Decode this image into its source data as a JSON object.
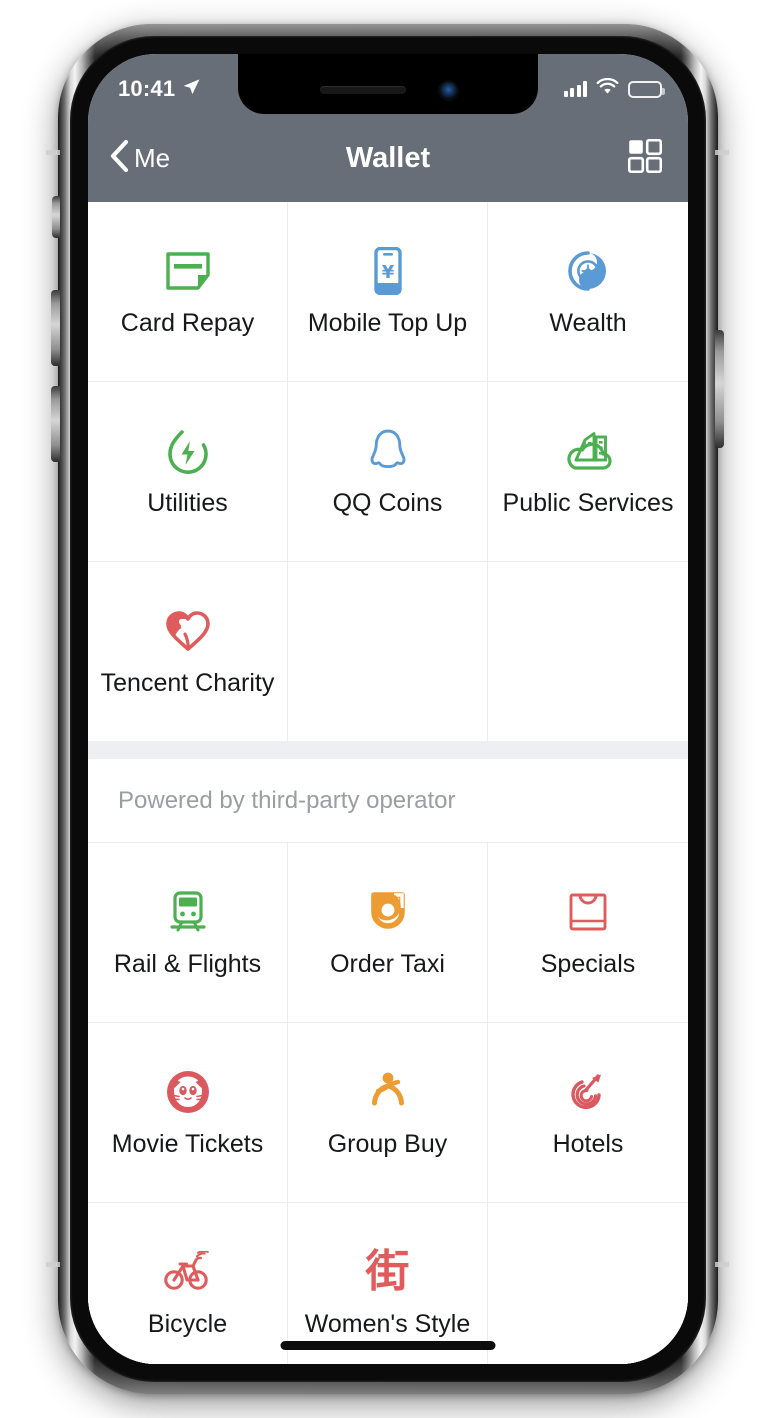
{
  "status_bar": {
    "time": "10:41",
    "location_icon": "location-arrow-icon",
    "signal_icon": "cellular-signal-icon",
    "wifi_icon": "wifi-icon",
    "battery_icon": "battery-icon"
  },
  "nav_bar": {
    "back_label": "Me",
    "back_icon": "chevron-left-icon",
    "title": "Wallet",
    "grid_icon": "grid-menu-icon"
  },
  "theme": {
    "nav_background": "#676e78",
    "green": "#4cb050",
    "blue": "#5b9bd5",
    "red": "#e05c5c",
    "orange": "#ed9b33",
    "battery_yellow": "#f7c744",
    "divider": "#eceded",
    "section_gap": "#eeeff2",
    "label_text": "#16181a",
    "muted_text": "#9a9da1"
  },
  "sections": [
    {
      "name": "wallet-services",
      "header": null,
      "rows": [
        [
          {
            "label": "Card Repay",
            "icon": "card-repay-icon",
            "color": "#4cb050",
            "empty": false
          },
          {
            "label": "Mobile Top Up",
            "icon": "mobile-topup-icon",
            "color": "#5b9bd5",
            "empty": false
          },
          {
            "label": "Wealth",
            "icon": "wealth-icon",
            "color": "#5b9bd5",
            "empty": false
          }
        ],
        [
          {
            "label": "Utilities",
            "icon": "utilities-icon",
            "color": "#4cb050",
            "empty": false
          },
          {
            "label": "QQ Coins",
            "icon": "qq-coins-icon",
            "color": "#5b9bd5",
            "empty": false
          },
          {
            "label": "Public Services",
            "icon": "public-services-icon",
            "color": "#4cb050",
            "empty": false
          }
        ],
        [
          {
            "label": "Tencent Charity",
            "icon": "tencent-charity-icon",
            "color": "#e05c5c",
            "empty": false
          },
          {
            "label": "",
            "icon": "",
            "color": "",
            "empty": true
          },
          {
            "label": "",
            "icon": "",
            "color": "",
            "empty": true
          }
        ]
      ]
    },
    {
      "name": "third-party-services",
      "header": "Powered by third-party operator",
      "rows": [
        [
          {
            "label": "Rail & Flights",
            "icon": "train-icon",
            "color": "#4cb050",
            "empty": false
          },
          {
            "label": "Order Taxi",
            "icon": "taxi-icon",
            "color": "#ed9b33",
            "empty": false
          },
          {
            "label": "Specials",
            "icon": "shopping-bag-icon",
            "color": "#e05c5c",
            "empty": false
          }
        ],
        [
          {
            "label": "Movie Tickets",
            "icon": "cat-face-icon",
            "color": "#d9595e",
            "empty": false
          },
          {
            "label": "Group Buy",
            "icon": "person-figure-icon",
            "color": "#ed9b33",
            "empty": false
          },
          {
            "label": "Hotels",
            "icon": "hotel-swirl-icon",
            "color": "#d9595e",
            "empty": false
          }
        ],
        [
          {
            "label": "Bicycle",
            "icon": "bicycle-icon",
            "color": "#e05c5c",
            "empty": false
          },
          {
            "label": "Women's Style",
            "icon": "street-glyph-icon",
            "color": "#e05c5c",
            "empty": false,
            "glyph": "街"
          },
          {
            "label": "",
            "icon": "",
            "color": "",
            "empty": true
          }
        ]
      ]
    }
  ],
  "home_indicator": "home-indicator"
}
